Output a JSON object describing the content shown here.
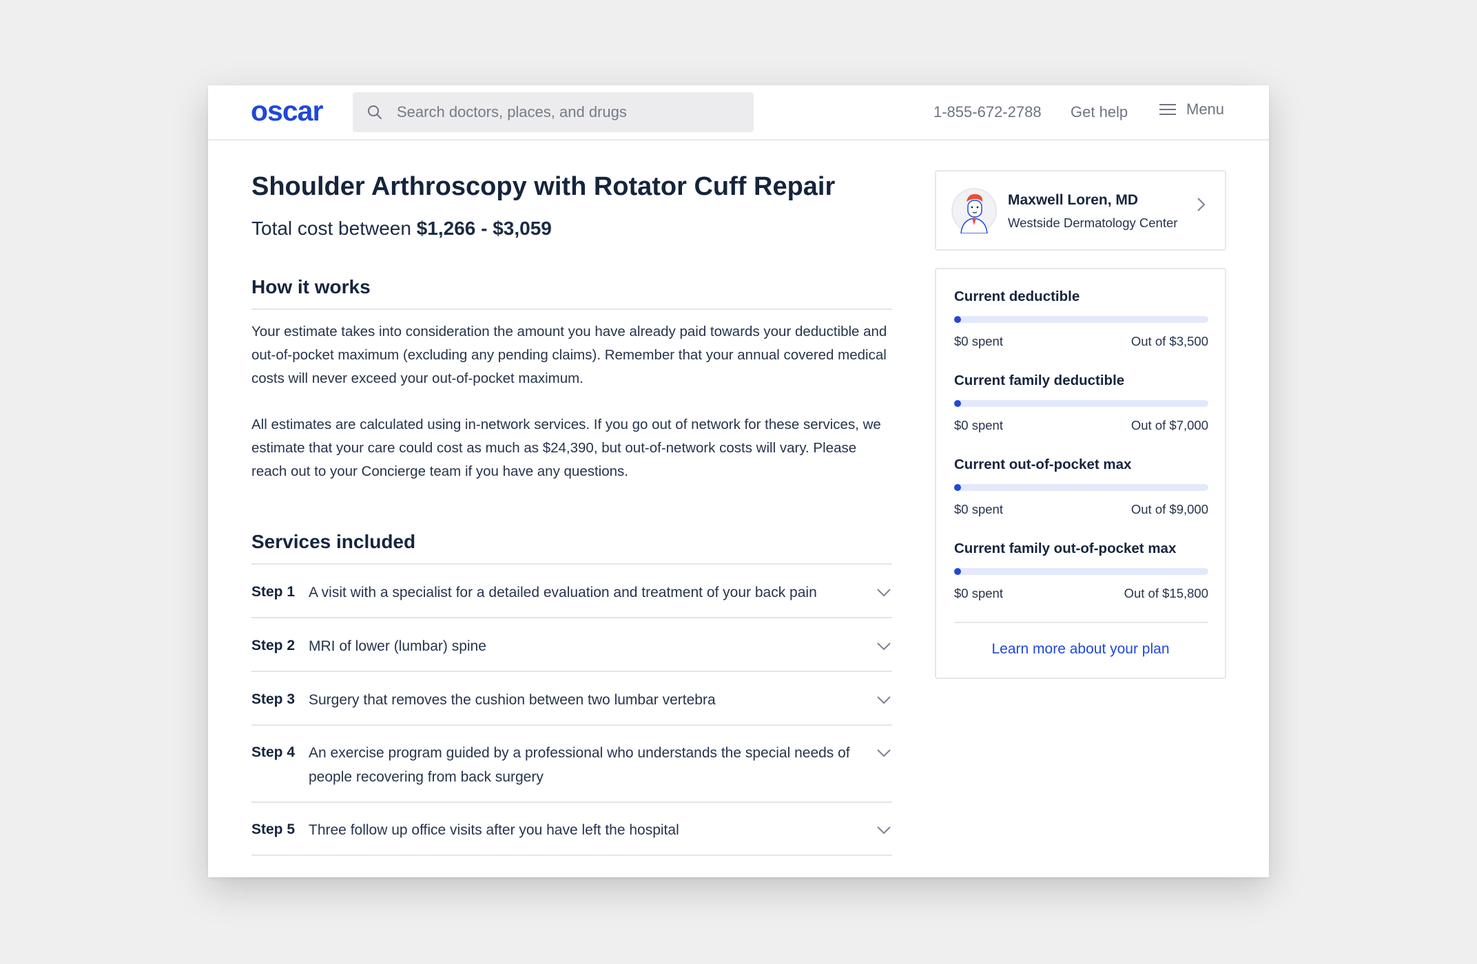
{
  "header": {
    "logo": "oscar",
    "search_placeholder": "Search doctors, places, and drugs",
    "phone": "1-855-672-2788",
    "help": "Get help",
    "menu": "Menu"
  },
  "main": {
    "title": "Shoulder Arthroscopy with Rotator Cuff Repair",
    "total_prefix": "Total cost between",
    "total_range": "$1,266 - $3,059",
    "how_heading": "How it works",
    "para1": "Your estimate takes into consideration the amount you have already paid towards your deductible and out-of-pocket maximum (excluding any pending claims).  Remember that your annual covered medical costs will never exceed your out-of-pocket maximum.",
    "para2": "All estimates are calculated using in-network services. If you go out of network for these services, we estimate that your care could cost as much as $24,390, but out-of-network costs will vary. Please reach out to your Concierge team if you have any questions.",
    "services_heading": "Services included",
    "steps": [
      {
        "label": "Step 1",
        "desc": "A visit with a specialist for a detailed evaluation and treatment of your back pain"
      },
      {
        "label": "Step 2",
        "desc": "MRI of lower (lumbar) spine"
      },
      {
        "label": "Step 3",
        "desc": "Surgery that removes the cushion between two lumbar vertebra"
      },
      {
        "label": "Step 4",
        "desc": "An exercise program guided by a professional who understands the special needs of people recovering from back surgery"
      },
      {
        "label": "Step 5",
        "desc": "Three follow up office visits after you have left the hospital"
      }
    ]
  },
  "doctor": {
    "name": "Maxwell Loren, MD",
    "place": "Westside Dermatology Center"
  },
  "plan": {
    "metrics": [
      {
        "label": "Current deductible",
        "spent": "$0 spent",
        "limit": "Out of $3,500",
        "progress": 0
      },
      {
        "label": "Current family deductible",
        "spent": "$0 spent",
        "limit": "Out of $7,000",
        "progress": 0
      },
      {
        "label": "Current out-of-pocket max",
        "spent": "$0 spent",
        "limit": "Out of $9,000",
        "progress": 0
      },
      {
        "label": "Current family out-of-pocket max",
        "spent": "$0 spent",
        "limit": "Out of $15,800",
        "progress": 0
      }
    ],
    "link": "Learn more about your plan"
  },
  "colors": {
    "brand": "#1f48d8",
    "text": "#16243d",
    "bar_track": "#e3e9fb"
  }
}
